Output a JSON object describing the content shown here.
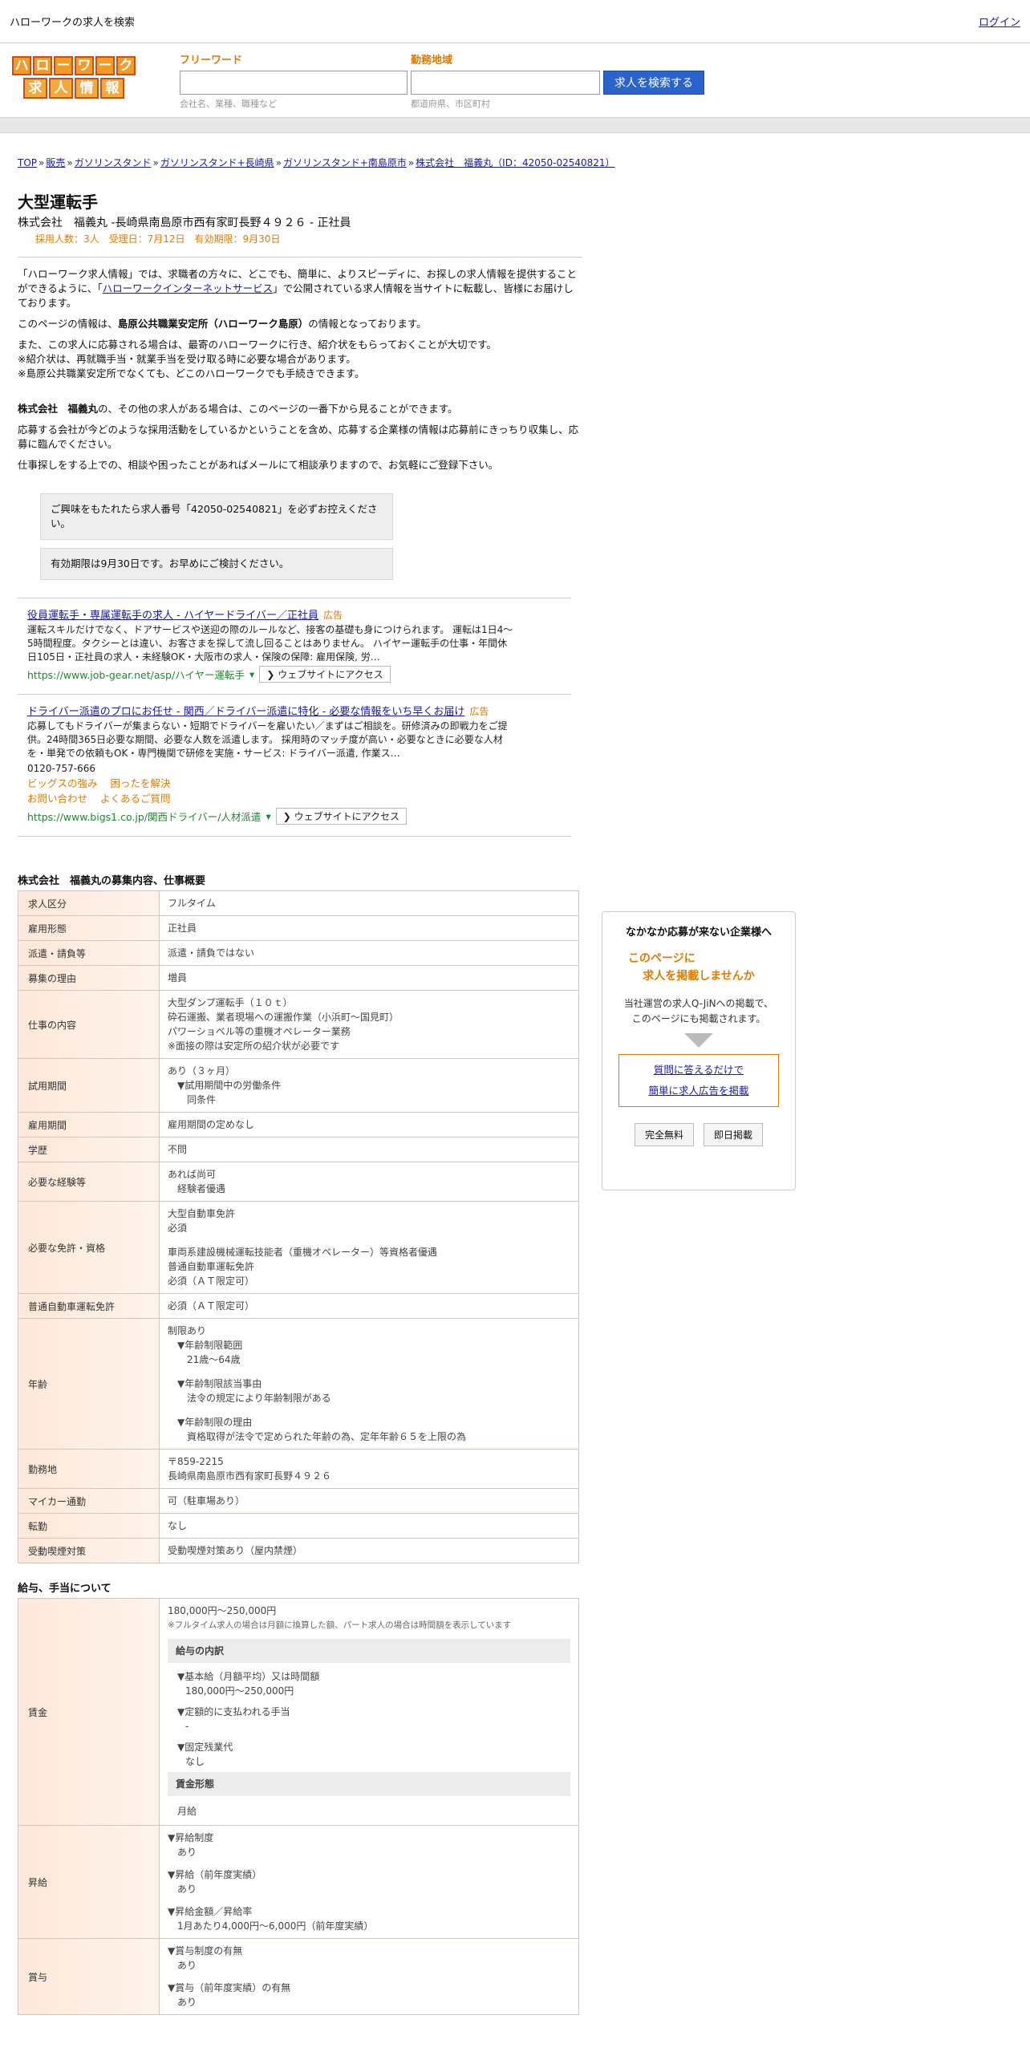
{
  "topbar": {
    "title": "ハローワークの求人を検索",
    "login": "ログイン"
  },
  "logo": {
    "row1": [
      "ハ",
      "ロ",
      "ー",
      "ワ",
      "ー",
      "ク"
    ],
    "row2": [
      "求",
      "人",
      "情",
      "報"
    ]
  },
  "search": {
    "freeword_label": "フリーワード",
    "freeword_placeholder": "",
    "freeword_hint": "会社名、業種、職種など",
    "area_label": "勤務地域",
    "area_placeholder": "",
    "area_hint": "都道府県、市区町村",
    "button": "求人を検索する"
  },
  "breadcrumb": [
    "TOP",
    "販売",
    "ガソリンスタンド",
    "ガソリンスタンド+長崎県",
    "ガソリンスタンド+南島原市",
    "株式会社　福義丸（ID：42050-02540821）"
  ],
  "breadcrumb_sep": "»",
  "job": {
    "title": "大型運転手",
    "subtitle": "株式会社　福義丸 -長崎県南島原市西有家町長野４９２６ - 正社員",
    "meta": "採用人数：3人　受理日：7月12日　有効期限：9月30日"
  },
  "intro": {
    "p1a": "「ハローワーク求人情報」では、求職者の方々に、どこでも、簡単に、よりスピーディに、お探しの求人情報を提供することができるように、「",
    "p1link": "ハローワークインターネットサービス",
    "p1b": "」で公開されている求人情報を当サイトに転載し、皆様にお届けしております。",
    "p2a": "このページの情報は、",
    "p2b": "島原公共職業安定所（ハローワーク島原）",
    "p2c": "の情報となっております。",
    "p3": "また、この求人に応募される場合は、最寄のハローワークに行き、紹介状をもらっておくことが大切です。",
    "p4": "※紹介状は、再就職手当・就業手当を受け取る時に必要な場合があります。",
    "p5": "※島原公共職業安定所でなくても、どこのハローワークでも手続きできます。",
    "p6a": "株式会社　福義丸",
    "p6b": "の、その他の求人がある場合は、このページの一番下から見ることができます。",
    "p7": "応募する会社が今どのような採用活動をしているかということを含め、応募する企業様の情報は応募前にきっちり収集し、応募に臨んでください。",
    "p8": "仕事探しをする上での、相談や困ったことがあればメールにて相談承りますので、お気軽にご登録下さい。"
  },
  "notices": [
    "ご興味をもたれたら求人番号「42050-02540821」を必ずお控えください。",
    "有効期限は9月30日です。お早めにご検討ください。"
  ],
  "ads": [
    {
      "title": "役員運転手・専属運転手の求人 - ハイヤードライバー／正社員",
      "badge": "広告",
      "body": "運転スキルだけでなく、ドアサービスや送迎の際のルールなど、接客の基礎も身につけられます。 運転は1日4～5時間程度。タクシーとは違い、お客さまを探して流し回ることはありません。 ハイヤー運転手の仕事・年間休日105日・正社員の求人・未経験OK・大阪市の求人・保険の保障: 雇用保険, 労…",
      "url": "https://www.job-gear.net/asp/ハイヤー運転手",
      "visit": "❯ ウェブサイトにアクセス"
    },
    {
      "title": "ドライバー派遣のプロにお任せ - 関西／ドライバー派遣に特化 - 必要な情報をいち早くお届け",
      "badge": "広告",
      "body": "応募してもドライバーが集まらない・短期でドライバーを雇いたい／まずはご相談を。研修済みの即戦力をご提供。24時間365日必要な期間、必要な人数を派遣します。 採用時のマッチ度が高い・必要なときに必要な人材を・単発での依頼もOK・専門機関で研修を実施・サービス: ドライバー派遣, 作業ス…",
      "phone": "0120-757-666",
      "sitelinks": [
        "ビッグスの強み",
        "困ったを解決",
        "お問い合わせ",
        "よくあるご質問"
      ],
      "url": "https://www.bigs1.co.jp/関西ドライバー/人材派遣",
      "visit": "❯ ウェブサイトにアクセス"
    }
  ],
  "section1": {
    "title": "株式会社　福義丸の募集内容、仕事概要",
    "rows": [
      {
        "k": "求人区分",
        "v": [
          "フルタイム"
        ]
      },
      {
        "k": "雇用形態",
        "v": [
          "正社員"
        ]
      },
      {
        "k": "派遣・請負等",
        "v": [
          "派遣・請負ではない"
        ]
      },
      {
        "k": "募集の理由",
        "v": [
          "増員"
        ]
      },
      {
        "k": "仕事の内容",
        "v": [
          "大型ダンプ運転手（１０ｔ）",
          "砕石運搬、業者現場への運搬作業（小浜町～国見町）",
          "パワーショベル等の重機オペレーター業務",
          "※面接の際は安定所の紹介状が必要です"
        ]
      },
      {
        "k": "試用期間",
        "v": [
          "あり（３ヶ月）",
          "　▼試用期間中の労働条件",
          "　　同条件"
        ]
      },
      {
        "k": "雇用期間",
        "v": [
          "雇用期間の定めなし"
        ]
      },
      {
        "k": "学歴",
        "v": [
          "不問"
        ]
      },
      {
        "k": "必要な経験等",
        "v": [
          "あれば尚可",
          "　経験者優遇"
        ]
      },
      {
        "k": "必要な免許・資格",
        "v": [
          "大型自動車免許",
          "必須",
          "",
          "車両系建設機械運転技能者（重機オペレーター）等資格者優遇",
          "普通自動車運転免許",
          "必須（ＡＴ限定可）"
        ]
      },
      {
        "k": "普通自動車運転免許",
        "v": [
          "必須（ＡＴ限定可）"
        ]
      },
      {
        "k": "年齢",
        "v": [
          "制限あり",
          "　▼年齢制限範囲",
          "　　21歳〜64歳",
          "",
          "　▼年齢制限該当事由",
          "　　法令の規定により年齢制限がある",
          "",
          "　▼年齢制限の理由",
          "　　資格取得が法令で定められた年齢の為、定年年齢６５を上限の為"
        ]
      },
      {
        "k": "勤務地",
        "v": [
          "〒859-2215",
          "長崎県南島原市西有家町長野４９２６"
        ]
      },
      {
        "k": "マイカー通勤",
        "v": [
          "可（駐車場あり）"
        ]
      },
      {
        "k": "転勤",
        "v": [
          "なし"
        ]
      },
      {
        "k": "受動喫煙対策",
        "v": [
          "受動喫煙対策あり（屋内禁煙）"
        ]
      }
    ]
  },
  "section2": {
    "title": "給与、手当について",
    "wage_key": "賃金",
    "wage_range": "180,000円〜250,000円",
    "wage_note": "※フルタイム求人の場合は月額に換算した額、パート求人の場合は時間額を表示しています",
    "breakdown_head": "給与の内訳",
    "breakdown": [
      {
        "label": "▼基本給（月額平均）又は時間額",
        "value": "180,000円〜250,000円"
      },
      {
        "label": "▼定額的に支払われる手当",
        "value": "-"
      },
      {
        "label": "▼固定残業代",
        "value": "なし"
      }
    ],
    "form_head": "賃金形態",
    "form_value": "月給",
    "raise_key": "昇給",
    "raise": [
      {
        "label": "▼昇給制度",
        "value": "あり"
      },
      {
        "label": "▼昇給（前年度実績）",
        "value": "あり"
      },
      {
        "label": "▼昇給金額／昇給率",
        "value": "1月あたり4,000円〜6,000円（前年度実績）"
      }
    ],
    "bonus_key": "賞与",
    "bonus": [
      {
        "label": "▼賞与制度の有無",
        "value": "あり"
      },
      {
        "label": "▼賞与（前年度実績）の有無",
        "value": "あり"
      }
    ]
  },
  "side": {
    "head": "なかなか応募が来ない企業様へ",
    "catch1": "このページに",
    "catch2": "求人を掲載しませんか",
    "desc1": "当社運営の求人Q-JiNへの掲載で、",
    "desc2": "このページにも掲載されます。",
    "link1": "質問に答えるだけで",
    "link2": "簡単に求人広告を掲載",
    "btn1": "完全無料",
    "btn2": "即日掲載"
  }
}
